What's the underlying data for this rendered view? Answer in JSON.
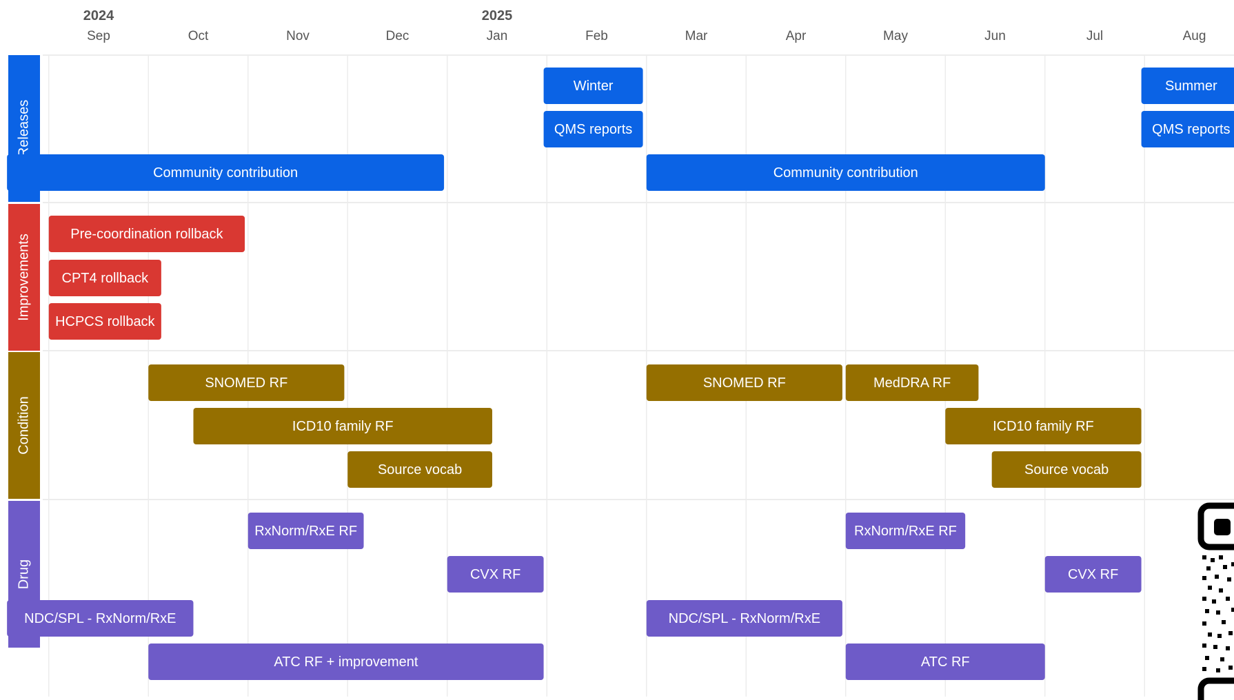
{
  "chart_data": {
    "type": "gantt",
    "years": [
      {
        "label": "2024",
        "month": "2024-09"
      },
      {
        "label": "2025",
        "month": "2025-01"
      }
    ],
    "months": [
      {
        "key": "2024-09",
        "label": "Sep"
      },
      {
        "key": "2024-10",
        "label": "Oct"
      },
      {
        "key": "2024-11",
        "label": "Nov"
      },
      {
        "key": "2024-12",
        "label": "Dec"
      },
      {
        "key": "2025-01",
        "label": "Jan"
      },
      {
        "key": "2025-02",
        "label": "Feb"
      },
      {
        "key": "2025-03",
        "label": "Mar"
      },
      {
        "key": "2025-04",
        "label": "Apr"
      },
      {
        "key": "2025-05",
        "label": "May"
      },
      {
        "key": "2025-06",
        "label": "Jun"
      },
      {
        "key": "2025-07",
        "label": "Jul"
      },
      {
        "key": "2025-08",
        "label": "Aug"
      }
    ],
    "lanes": [
      {
        "name": "Releases",
        "color": "#0b63e5",
        "tasks": [
          {
            "label": "Winter",
            "start": "2025-01-31",
            "end": "2025-02-28",
            "row": 0
          },
          {
            "label": "QMS reports",
            "start": "2025-01-31",
            "end": "2025-02-28",
            "row": 1
          },
          {
            "label": "Community contribution",
            "start": "2024-08-19",
            "end": "2024-12-31",
            "row": 2
          },
          {
            "label": "Community contribution",
            "start": "2025-03-01",
            "end": "2025-07-01",
            "row": 2
          },
          {
            "label": "Summer",
            "start": "2025-07-31",
            "end": "2025-08-31",
            "row": 0
          },
          {
            "label": "QMS reports",
            "start": "2025-07-31",
            "end": "2025-08-31",
            "row": 1
          }
        ]
      },
      {
        "name": "Improvements",
        "color": "#d93832",
        "tasks": [
          {
            "label": "Pre-coordination rollback",
            "start": "2024-09-01",
            "end": "2024-10-31",
            "row": 0
          },
          {
            "label": "CPT4 rollback",
            "start": "2024-09-01",
            "end": "2024-10-05",
            "row": 1
          },
          {
            "label": "HCPCS rollback",
            "start": "2024-09-01",
            "end": "2024-10-05",
            "row": 2
          }
        ]
      },
      {
        "name": "Condition",
        "color": "#956f00",
        "tasks": [
          {
            "label": "SNOMED RF",
            "start": "2024-10-01",
            "end": "2024-11-30",
            "row": 0
          },
          {
            "label": "ICD10 family RF",
            "start": "2024-10-15",
            "end": "2025-01-15",
            "row": 1
          },
          {
            "label": "Source vocab",
            "start": "2024-12-01",
            "end": "2025-01-15",
            "row": 2
          },
          {
            "label": "SNOMED RF",
            "start": "2025-03-01",
            "end": "2025-04-30",
            "row": 0
          },
          {
            "label": "MedDRA RF",
            "start": "2025-05-01",
            "end": "2025-06-11",
            "row": 0
          },
          {
            "label": "ICD10 family RF",
            "start": "2025-06-01",
            "end": "2025-07-31",
            "row": 1
          },
          {
            "label": "Source vocab",
            "start": "2025-06-15",
            "end": "2025-07-31",
            "row": 2
          }
        ]
      },
      {
        "name": "Drug",
        "color": "#6e5bc8",
        "tasks": [
          {
            "label": "RxNorm/RxE RF",
            "start": "2024-11-01",
            "end": "2024-12-06",
            "row": 0
          },
          {
            "label": "CVX RF",
            "start": "2025-01-01",
            "end": "2025-01-31",
            "row": 1
          },
          {
            "label": "NDC/SPL - RxNorm/RxE",
            "start": "2024-08-19",
            "end": "2024-10-15",
            "row": 2
          },
          {
            "label": "ATC RF + improvement",
            "start": "2024-10-01",
            "end": "2025-01-31",
            "row": 3
          },
          {
            "label": "RxNorm/RxE RF",
            "start": "2025-05-01",
            "end": "2025-06-07",
            "row": 0
          },
          {
            "label": "CVX RF",
            "start": "2025-07-01",
            "end": "2025-07-31",
            "row": 1
          },
          {
            "label": "NDC/SPL - RxNorm/RxE",
            "start": "2025-03-01",
            "end": "2025-04-30",
            "row": 2
          },
          {
            "label": "ATC RF",
            "start": "2025-05-01",
            "end": "2025-07-01",
            "row": 3
          }
        ]
      }
    ]
  }
}
